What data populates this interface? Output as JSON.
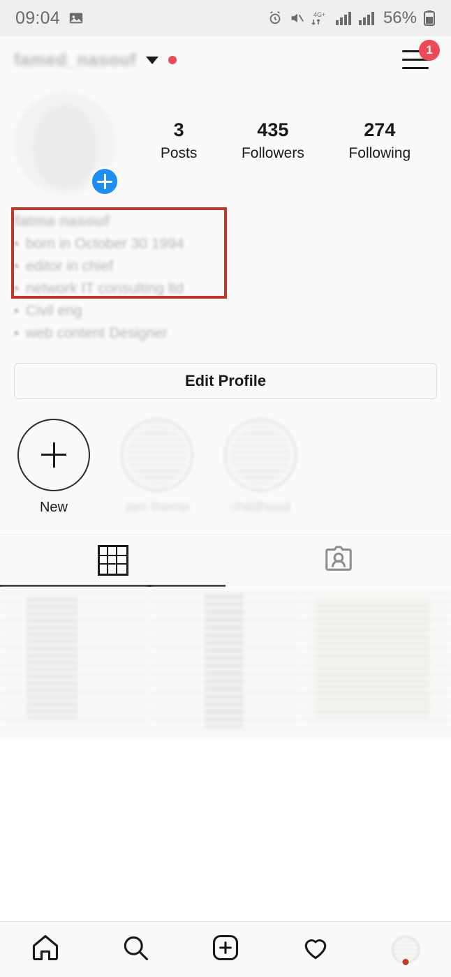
{
  "status_bar": {
    "time": "09:04",
    "battery_percent": "56%",
    "network_label": "4G+",
    "icons": [
      "image-icon",
      "alarm-icon",
      "mute-icon",
      "data-transfer-icon",
      "signal-bars-icon",
      "signal-bars-icon",
      "battery-icon"
    ]
  },
  "app_bar": {
    "username": "famed_nasouf",
    "dropdown_icon": "chevron-down-icon",
    "live_dot": true,
    "menu_icon": "hamburger-menu-icon",
    "menu_badge": "1"
  },
  "profile": {
    "avatar_name": "profile-avatar",
    "add_story_label": "+",
    "stats": [
      {
        "value": "3",
        "label": "Posts"
      },
      {
        "value": "435",
        "label": "Followers"
      },
      {
        "value": "274",
        "label": "Following"
      }
    ],
    "display_name": "fatma nasouf",
    "bio_lines": [
      "born in October 30 1994",
      "editor in chief",
      "network IT consulting ltd",
      "Civil eng",
      "web content Designer"
    ],
    "edit_button": "Edit Profile"
  },
  "annotation": {
    "highlight_color": "#c0392b",
    "target": "bio-lines"
  },
  "highlights": [
    {
      "label": "New",
      "type": "new"
    },
    {
      "label": "zen theme",
      "type": "image"
    },
    {
      "label": "childhood",
      "type": "image"
    }
  ],
  "tabs": [
    {
      "name": "grid",
      "icon": "grid-icon",
      "active": true
    },
    {
      "name": "tagged",
      "icon": "tagged-person-icon",
      "active": false
    }
  ],
  "posts": [
    {
      "name": "post-thumbnail-1"
    },
    {
      "name": "post-thumbnail-2"
    },
    {
      "name": "post-thumbnail-3"
    }
  ],
  "bottom_nav": [
    {
      "name": "home",
      "icon": "home-icon"
    },
    {
      "name": "search",
      "icon": "search-icon"
    },
    {
      "name": "create",
      "icon": "plus-square-icon"
    },
    {
      "name": "activity",
      "icon": "heart-icon"
    },
    {
      "name": "profile",
      "icon": "profile-avatar-icon"
    }
  ]
}
